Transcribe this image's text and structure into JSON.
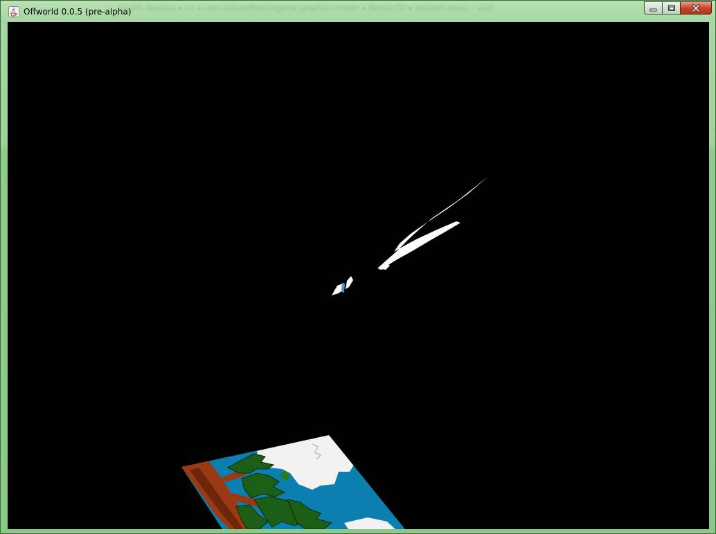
{
  "window": {
    "title": "Offworld 0.0.5 (pre-alpha)",
    "app_icon": "java-coffee-cup-icon",
    "frame_color": "#9fd39a",
    "background_breadcrumb": "Fourth desktop  ▸  src  ▸  com.detuvoffworldgame.graphics.render  ▸  Render2D  ▸  renderScene() : void"
  },
  "caption_buttons": {
    "minimize_icon": "minimize-icon",
    "maximize_icon": "restore-icon",
    "close_icon": "close-icon",
    "close_color": "#c8452c"
  },
  "scene": {
    "background": "#000000",
    "objects": [
      {
        "name": "white-wing-sprite",
        "icon": "wing-shape"
      },
      {
        "name": "small-ship-sprite",
        "icon": "ship-shape",
        "accent": "#4a8fe0"
      },
      {
        "name": "island-tile",
        "icon": "palm-island",
        "colors": [
          "#0a7fb0",
          "#1d5e16",
          "#9a3a14",
          "#f0f0f0"
        ]
      }
    ]
  }
}
